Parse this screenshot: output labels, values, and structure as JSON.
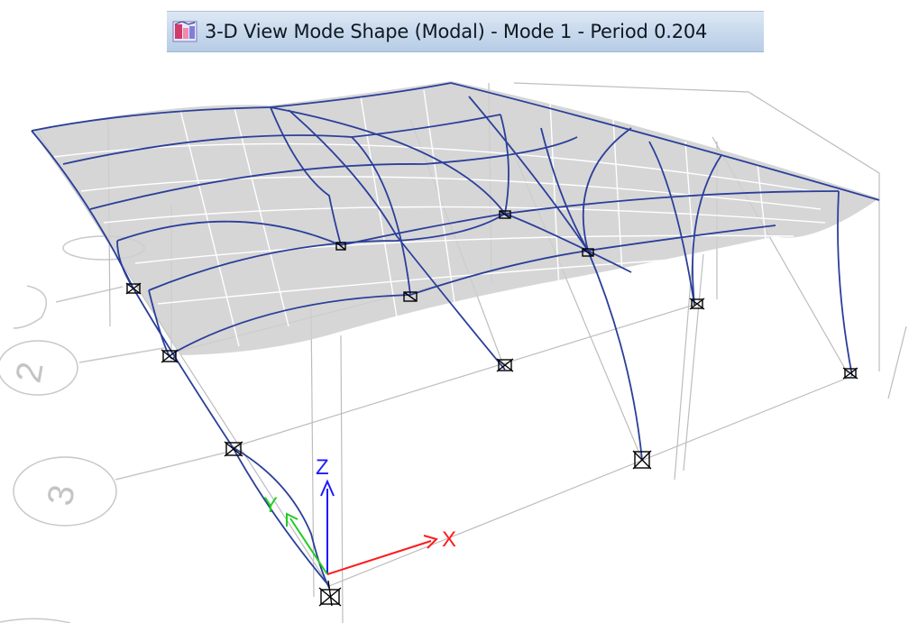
{
  "window": {
    "title": "3-D View  Mode Shape (Modal) - Mode 1 - Period 0.204",
    "icon": "etabs-3d-view-icon"
  },
  "grid_bubbles": [
    "2",
    "3"
  ],
  "axes": {
    "x": "X",
    "y": "Y",
    "z": "Z",
    "x_color": "#ff1a1a",
    "y_color": "#22cc22",
    "z_color": "#1a1aff"
  },
  "colors": {
    "deformed_member": "#2b3f9a",
    "slab_fill": "#cfcfcf",
    "undeformed_frame": "#bdbdbd",
    "support": "#000000"
  }
}
